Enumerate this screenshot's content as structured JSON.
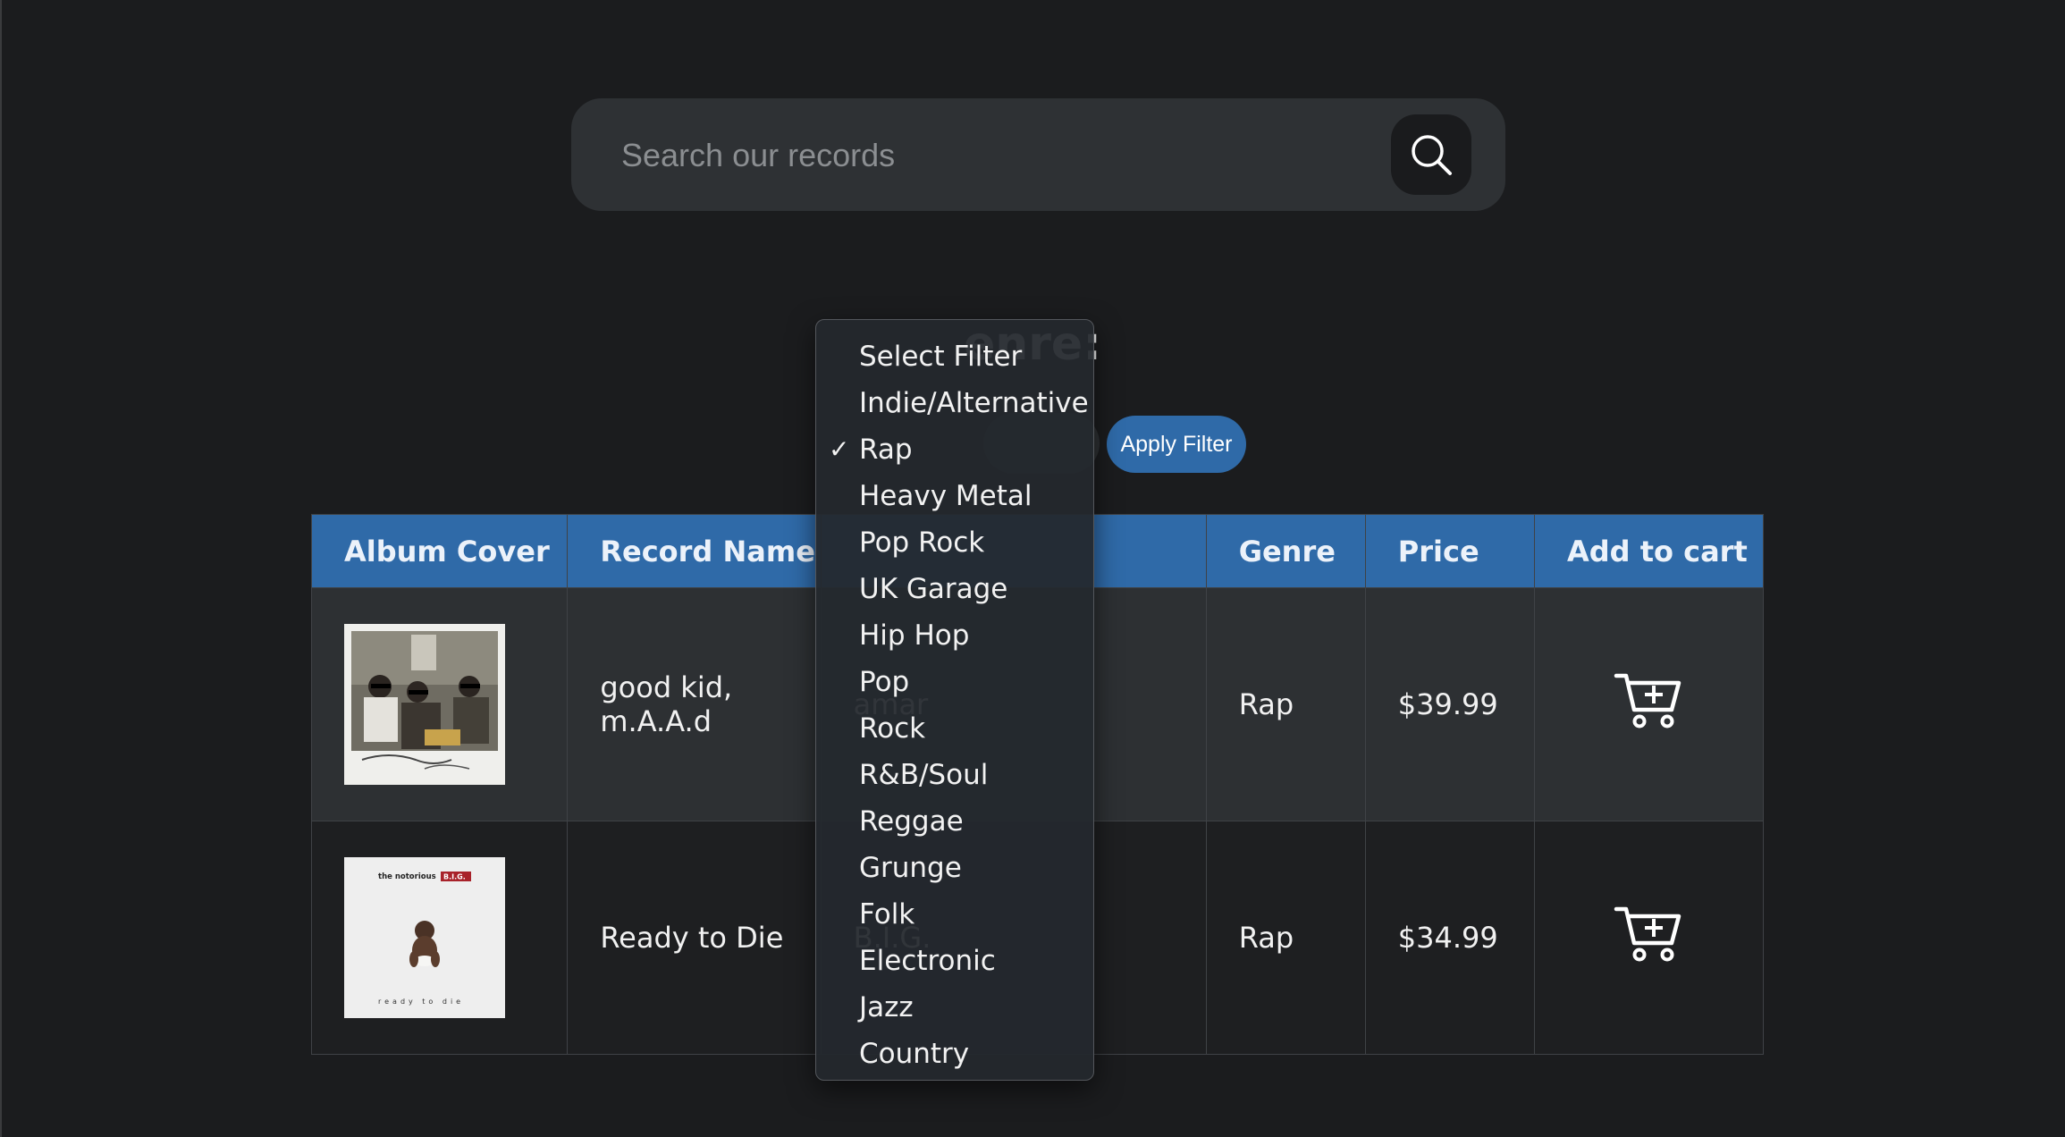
{
  "search": {
    "placeholder": "Search our records",
    "button_icon": "search-icon"
  },
  "filter": {
    "heading": "enre:",
    "apply_label": "Apply Filter",
    "selected": "Rap",
    "options": [
      "Select Filter",
      "Indie/Alternative",
      "Rap",
      "Heavy Metal",
      "Pop Rock",
      "UK Garage",
      "Hip Hop",
      "Pop",
      "Rock",
      "R&B/Soul",
      "Reggae",
      "Grunge",
      "Folk",
      "Electronic",
      "Jazz",
      "Country"
    ],
    "check_mark": "✓"
  },
  "table": {
    "headers": [
      "Album Cover",
      "Record Name",
      "",
      "Genre",
      "Price",
      "Add to cart"
    ],
    "rows": [
      {
        "record_name": "good kid, m.A.A.d",
        "artist": "amar",
        "genre": "Rap",
        "price": "$39.99",
        "cart_icon": "add-to-cart-icon"
      },
      {
        "record_name": "Ready to Die",
        "artist": "B.I.G.",
        "genre": "Rap",
        "price": "$34.99",
        "cart_icon": "add-to-cart-icon",
        "cover_text_top": "the notorious",
        "cover_text_badge": "B.I.G.",
        "cover_text_bottom": "ready to die"
      }
    ]
  },
  "colors": {
    "background": "#1b1c1e",
    "header_blue": "#2f6aa8",
    "search_bg": "#2e3134",
    "row_light": "#2d3033",
    "row_dark": "#1e1f21"
  }
}
